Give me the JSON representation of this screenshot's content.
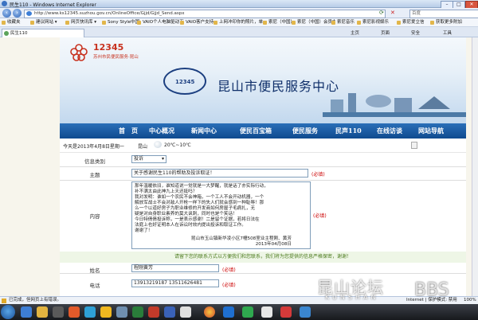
{
  "window": {
    "title": "民生110 - Windows Internet Explorer",
    "controls": [
      "–",
      "□",
      "✕"
    ]
  },
  "address": {
    "url": "http://www.ks12345.suzhou.gov.cn/OnlineOffice/Gjjd/Gjjd_Send.aspx",
    "search_placeholder": "百度"
  },
  "favorites": {
    "label": "收藏夹",
    "items": [
      "建议网站 ▾",
      "网页快讯库 ▾",
      "Sony Style中国",
      "VAIO个人电脑驱动下载",
      "VAIO客户支持",
      "上网冲印你的照片，单一...",
      "索尼（中国）",
      "索尼（中国）会员中心",
      "索尼音乐",
      "索尼影视娱乐",
      "索尼爱立信",
      "获取更多附加"
    ]
  },
  "tab": {
    "title": "民生110",
    "tools": [
      "主页",
      "页面",
      "安全",
      "工具"
    ]
  },
  "site": {
    "logo_number": "12345",
    "logo_sub": "苏州市民便民服务·昆山",
    "title": "昆山市便民服务中心",
    "eye_text": "12345",
    "nav": [
      "首　页",
      "中心概况",
      "新闻中心",
      "便民百宝箱",
      "便民服务",
      "民声110",
      "在线访谈",
      "网站导航"
    ]
  },
  "info": {
    "date": "今天是2013年4月8日星期一",
    "city": "昆山",
    "temp": "20℃~10℃"
  },
  "form": {
    "category_label": "信息类别",
    "category_value": "投诉",
    "subject_label": "主题",
    "subject_value": "关于感谢民生110的帮助及投诉取证！",
    "content_label": "内容",
    "content_lines": [
      "那年温暖依旧，谁知道说一觉就是一大梦醒，就是话了亦实际行动，",
      "补不满太由此神九上天还挺吗？",
      "我对发明：谁如一个农民不会神箱，一个工人不会开动机器，一个",
      "解放军战士不会对敌人开枪一样下的失人们就会感到一种耻辱！那",
      "么一个以道好房子为职业维修的开发商如何房屋子毛病扎，无",
      "疑是对自身职业素养的莫大讽刺，同时也是个笑话！",
      "今日特倩倩投诉称，一是表示感谢！二是留个证据，若将日法在",
      "法庭上也好证明本人在诉讼时效内提出投诉和取证工作。",
      "谢谢了！"
    ],
    "content_sig1": "昆山市玉山镇新华凌小区7幢508室业主程刚、黄芳",
    "content_sig2": "2013年04月08日",
    "required": "(必填)",
    "notice": "请留下您的联系方式以方便我们和您联系，我们将为您提供的信息严格保密，谢谢！",
    "name_label": "姓名",
    "name_value": "程刚黄芳",
    "phone_label": "电话",
    "phone_value": "13913219187 13511626481"
  },
  "status": {
    "text": "已完成，但网页上有错误。",
    "zone": "Internet | 保护模式: 禁用",
    "zoom": "100%"
  },
  "watermark": {
    "cn": "昆山论坛",
    "en": "KUNSHAN",
    "bbs": "BBS"
  }
}
